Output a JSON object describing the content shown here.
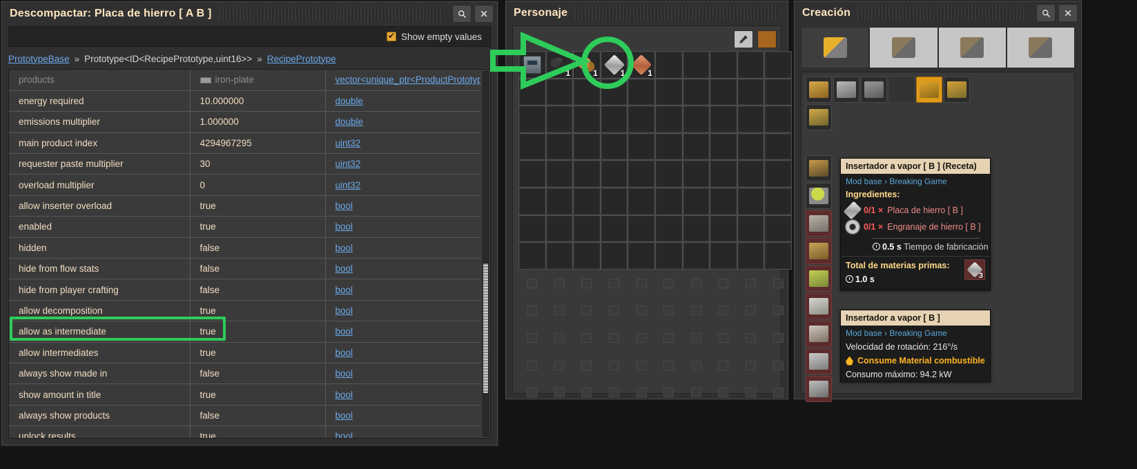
{
  "left_panel": {
    "title": "Descompactar: Placa de hierro [ A B ]",
    "search_icon": "magnifier-icon",
    "close_icon": "close-icon",
    "show_empty_label": "Show empty values",
    "breadcrumb": [
      {
        "text": "PrototypeBase",
        "link": true
      },
      {
        "text": "»",
        "link": false
      },
      {
        "text": "Prototype<ID<RecipePrototype,uint16>>",
        "link": false
      },
      {
        "text": "»",
        "link": false
      },
      {
        "text": "RecipePrototype",
        "link": true
      }
    ],
    "rows": [
      {
        "name": "products",
        "value": "iron-plate",
        "type": "vector<unique_ptr<ProductPrototype>>",
        "clipped": true,
        "has_icon": true
      },
      {
        "name": "energy required",
        "value": "10.000000",
        "type": "double"
      },
      {
        "name": "emissions multiplier",
        "value": "1.000000",
        "type": "double"
      },
      {
        "name": "main product index",
        "value": "4294967295",
        "type": "uint32"
      },
      {
        "name": "requester paste multiplier",
        "value": "30",
        "type": "uint32"
      },
      {
        "name": "overload multiplier",
        "value": "0",
        "type": "uint32"
      },
      {
        "name": "allow inserter overload",
        "value": "true",
        "type": "bool"
      },
      {
        "name": "enabled",
        "value": "true",
        "type": "bool"
      },
      {
        "name": "hidden",
        "value": "false",
        "type": "bool"
      },
      {
        "name": "hide from flow stats",
        "value": "false",
        "type": "bool"
      },
      {
        "name": "hide from player crafting",
        "value": "false",
        "type": "bool"
      },
      {
        "name": "allow decomposition",
        "value": "true",
        "type": "bool"
      },
      {
        "name": "allow as intermediate",
        "value": "true",
        "type": "bool",
        "highlighted": true
      },
      {
        "name": "allow intermediates",
        "value": "true",
        "type": "bool"
      },
      {
        "name": "always show made in",
        "value": "false",
        "type": "bool"
      },
      {
        "name": "show amount in title",
        "value": "true",
        "type": "bool"
      },
      {
        "name": "always show products",
        "value": "false",
        "type": "bool"
      },
      {
        "name": "unlock results",
        "value": "true",
        "type": "bool"
      }
    ]
  },
  "character_panel": {
    "title": "Personaje",
    "pick_icon": "eyedropper-icon",
    "color_swatch": "#a8651f",
    "grid_columns": 10,
    "grid_rows_active": 8,
    "grid_rows_locked": 5,
    "items": [
      {
        "index": 0,
        "art": "machine",
        "count": "",
        "name": "machine-item"
      },
      {
        "index": 1,
        "art": "coal",
        "count": "1",
        "name": "coal-item"
      },
      {
        "index": 2,
        "art": "iron-ore",
        "count": "1",
        "name": "iron-ore-item"
      },
      {
        "index": 3,
        "art": "iron-plate",
        "count": "1",
        "name": "iron-plate-item"
      },
      {
        "index": 4,
        "art": "copper-plate",
        "count": "1",
        "name": "copper-plate-item"
      }
    ]
  },
  "annotations": {
    "arrow_color": "#2ecc5a",
    "circle_color": "#2ecc5a",
    "row_box_color": "#2ecc5a"
  },
  "craft_panel": {
    "title": "Creación",
    "search_icon": "magnifier-icon",
    "close_icon": "close-icon",
    "tabs": [
      {
        "name": "tab-logistics",
        "icon": "yellow-inserter-icon",
        "active": true
      },
      {
        "name": "tab-production",
        "icon": "assembler-icon",
        "active": false
      },
      {
        "name": "tab-intermediate",
        "icon": "gear-circuit-icon",
        "active": false
      },
      {
        "name": "tab-combat",
        "icon": "gun-icon",
        "active": false
      }
    ],
    "group_slots": [
      {
        "name": "slot-wooden-chest",
        "art": "chest",
        "selected": false
      },
      {
        "name": "slot-iron-chest",
        "art": "chest-iron",
        "selected": false
      },
      {
        "name": "slot-belt",
        "art": "belt",
        "selected": false
      },
      {
        "name": "slot-empty-1",
        "art": "blank",
        "selected": false
      },
      {
        "name": "slot-inserter",
        "art": "inserter",
        "selected": true
      },
      {
        "name": "slot-long-inserter",
        "art": "inserter2",
        "selected": false
      },
      {
        "name": "slot-fast-inserter",
        "art": "inserter3",
        "selected": false
      }
    ],
    "recipe_slots": [
      {
        "name": "recipe-pumpjack",
        "art": "pole",
        "red": false
      },
      {
        "name": "recipe-lamp",
        "art": "lamp",
        "red": false
      },
      {
        "name": "recipe-stone",
        "art": "stone",
        "red": true
      },
      {
        "name": "recipe-wood-box",
        "art": "woodbox",
        "red": true
      },
      {
        "name": "recipe-green-machine",
        "art": "greenmach",
        "red": true
      },
      {
        "name": "recipe-drill",
        "art": "drill",
        "red": true
      },
      {
        "name": "recipe-steam-inserter",
        "art": "steamins",
        "red": true
      },
      {
        "name": "recipe-grey-machine",
        "art": "greymach",
        "red": true
      },
      {
        "name": "recipe-assembler2",
        "art": "assembler",
        "red": true
      }
    ],
    "tooltip_recipe": {
      "header": "Insertador a vapor [ B ] (Receta)",
      "subtitle": "Mod base › Breaking Game",
      "ingredients_label": "Ingredientes:",
      "ingredients": [
        {
          "qty": "0/1 ×",
          "name": "Placa de hierro [ B ]",
          "art": "iron-plate"
        },
        {
          "qty": "0/1 ×",
          "name": "Engranaje de hierro [ B ]",
          "art": "gear"
        }
      ],
      "craft_time_value": "0.5 s",
      "craft_time_label": "Tiempo de fabricación",
      "totals_label": "Total de materias primas:",
      "totals_time": "1.0 s",
      "totals_item_count": "3",
      "totals_item_art": "iron-plate"
    },
    "tooltip_entity": {
      "header": "Insertador a vapor [ B ]",
      "subtitle": "Mod base › Breaking Game",
      "rotation_line": "Velocidad de rotación: 216°/s",
      "fuel_warning": "Consume Material combustible",
      "consumption_line": "Consumo máximo: 94.2 kW"
    }
  }
}
